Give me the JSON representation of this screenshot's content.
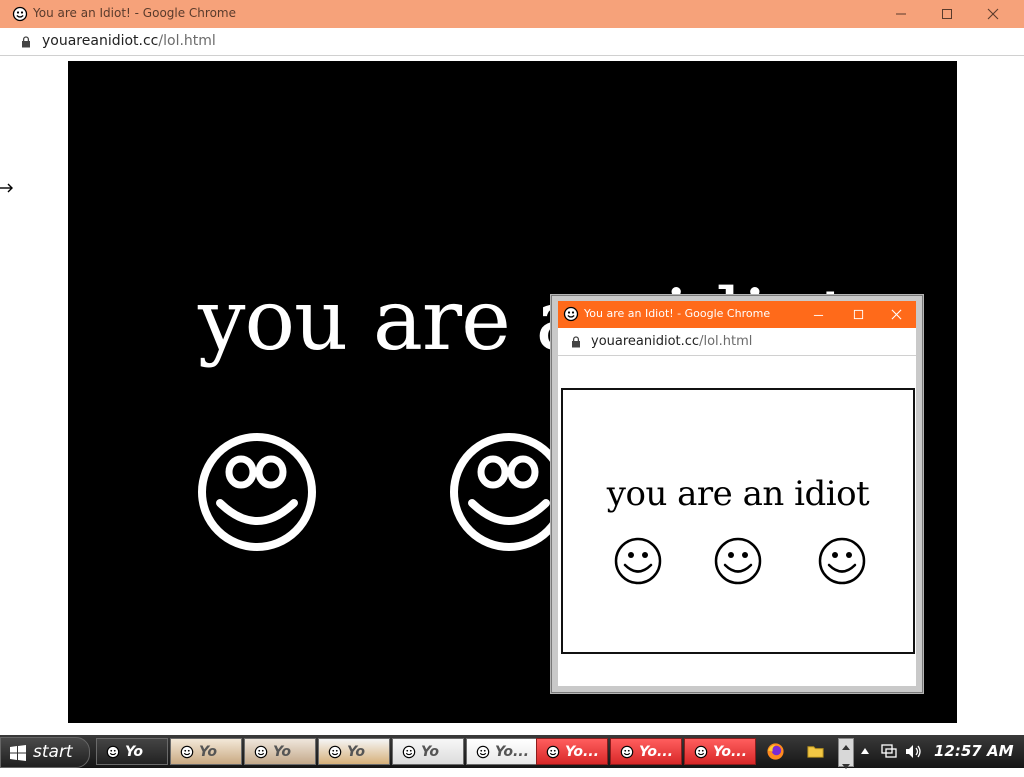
{
  "main_window": {
    "title": "You are an Idiot! - Google Chrome",
    "url_host": "youareanidiot.cc",
    "url_path": "/lol.html",
    "headline": "you are an idiot"
  },
  "popup_window": {
    "title": "You are an Idiot! - Google Chrome",
    "url_host": "youareanidiot.cc",
    "url_path": "/lol.html",
    "headline": "you are an idiot"
  },
  "taskbar": {
    "start_label": "start",
    "buttons": [
      {
        "label": "Yo"
      },
      {
        "label": "Yo"
      },
      {
        "label": "Yo"
      },
      {
        "label": "Yo"
      },
      {
        "label": "Yo"
      },
      {
        "label": "Yo..."
      },
      {
        "label": "Yo..."
      },
      {
        "label": "Yo..."
      },
      {
        "label": "Yo..."
      }
    ],
    "clock": "12:57 AM"
  },
  "icons": {
    "window_icon": "smiley-face-icon",
    "lock": "lock-icon",
    "minimize": "minimize-icon",
    "maximize": "maximize-icon",
    "close": "close-icon"
  },
  "colors": {
    "main_titlebar": "#f6a27a",
    "popup_titlebar": "#ff6a1a",
    "taskbar_active": "#d82828"
  }
}
